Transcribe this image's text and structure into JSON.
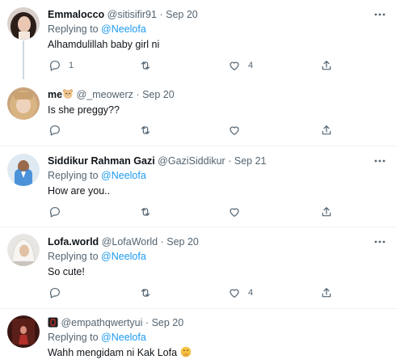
{
  "tweets": [
    {
      "name": "Emmalocco",
      "handle": "@sitisifir91",
      "date": "Sep 20",
      "replying_label": "Replying to",
      "replying_to": "@Neelofa",
      "text": "Alhamdulillah baby girl ni",
      "replies": "1",
      "retweets": "",
      "likes": "4",
      "avatar_icon": "avatar-woman-dark-hair"
    },
    {
      "name": "me",
      "handle": "@_meowerz",
      "date": "Sep 20",
      "text": "Is she preggy??",
      "replies": "",
      "retweets": "",
      "likes": "",
      "name_emoji": "bear-face-emoji",
      "avatar_icon": "avatar-blonde-hair"
    },
    {
      "name": "Siddikur Rahman Gazi",
      "handle": "@GaziSiddikur",
      "date": "Sep 21",
      "replying_label": "Replying to",
      "replying_to": "@Neelofa",
      "text": "How are you..",
      "replies": "",
      "retweets": "",
      "likes": "",
      "avatar_icon": "avatar-man-blue-shirt"
    },
    {
      "name": "Lofa.world",
      "handle": "@LofaWorld",
      "date": "Sep 20",
      "replying_label": "Replying to",
      "replying_to": "@Neelofa",
      "text": "So cute!",
      "replies": "",
      "retweets": "",
      "likes": "4",
      "avatar_icon": "avatar-woman-white-hijab"
    },
    {
      "name": "",
      "handle": "@empathqwertyui",
      "date": "Sep 20",
      "replying_label": "Replying to",
      "replying_to": "@Neelofa",
      "text": "Wahh mengidam ni Kak Lofa",
      "name_emoji": "dark-square-emoji",
      "text_emoji": "hand-over-mouth-emoji",
      "avatar_icon": "avatar-dark-red-photo"
    }
  ],
  "colors": {
    "text": "#0f1419",
    "secondary": "#536471",
    "link": "#1d9bf0",
    "separator": "#eff3f4",
    "thread_line": "#cfd9de"
  }
}
